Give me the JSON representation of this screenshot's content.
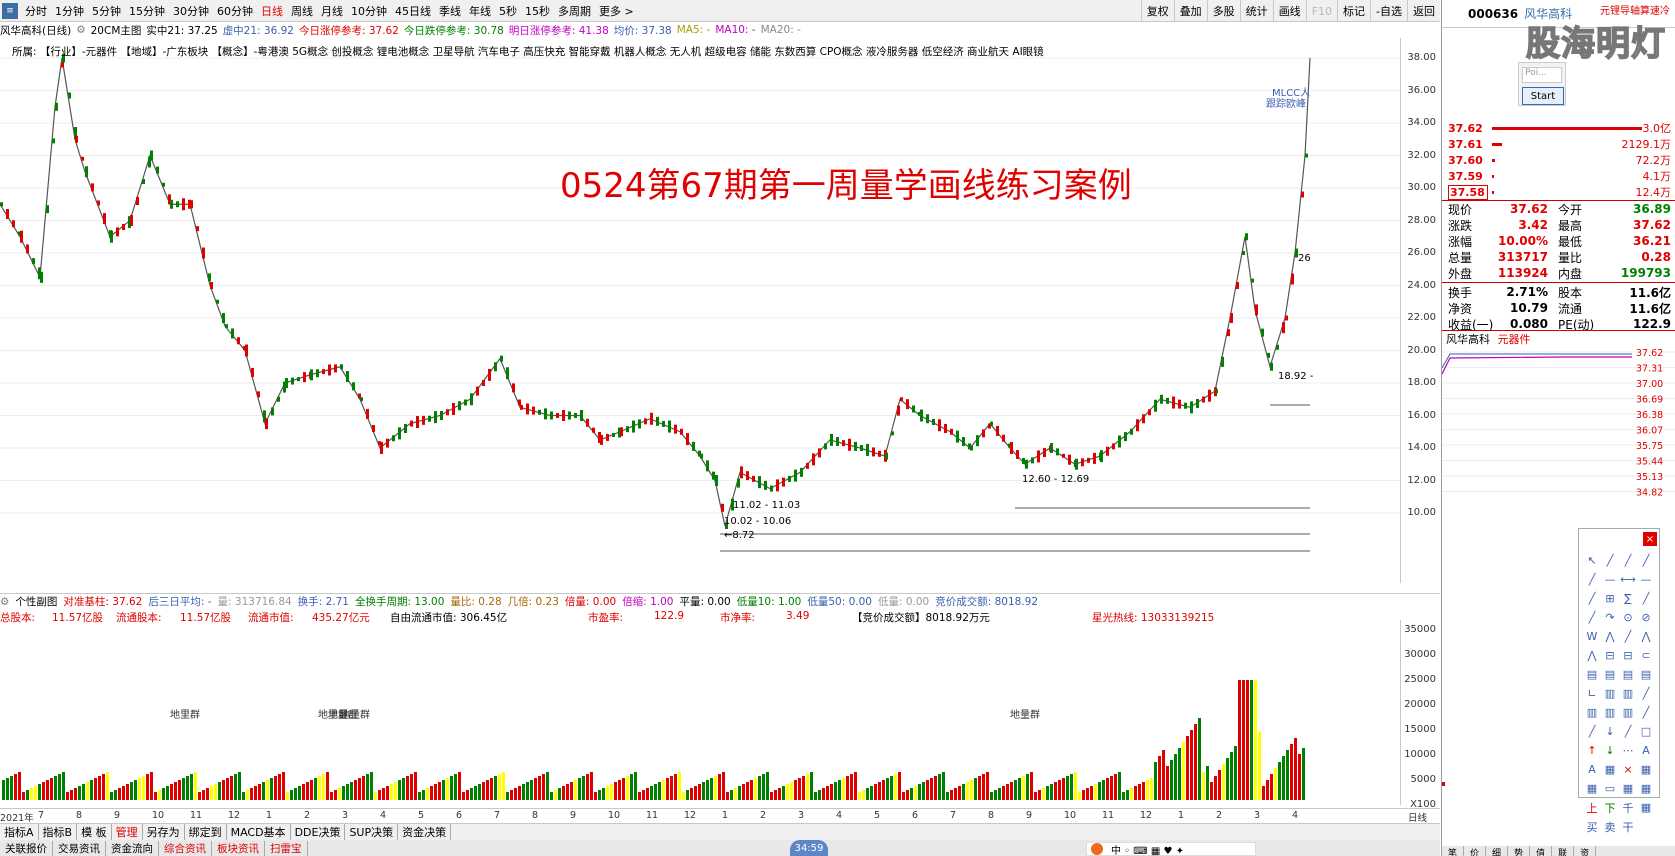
{
  "topbar": {
    "periods": [
      "分时",
      "1分钟",
      "5分钟",
      "15分钟",
      "30分钟",
      "60分钟",
      "日线",
      "周线",
      "月线",
      "10分钟",
      "45日线",
      "季线",
      "年线",
      "5秒",
      "15秒",
      "多周期",
      "更多 >"
    ],
    "active_period": "日线",
    "right_buttons": [
      "复权",
      "叠加",
      "多股",
      "统计",
      "画线",
      "F10",
      "标记",
      "-自选",
      "返回"
    ]
  },
  "infoline": {
    "title": "风华高科(日线)",
    "main_indicator": "20CM主图",
    "realtime": "实中21: 37.25",
    "virtual": "虚中21: 36.92",
    "limit_up_ref": "今日涨停参考: 37.62",
    "limit_down_ref": "今日跌停参考: 30.78",
    "tomorrow_ref": "明日涨停参考: 41.38",
    "avg_price": "均价: 37.38",
    "ma5": "MA5: -",
    "ma10": "MA10: -",
    "ma20": "MA20: -"
  },
  "concept_line": "所属:   【行业】-元器件  【地域】-广东板块     【概念】-粤港澳 5G概念 创投概念 锂电池概念 卫星导航 汽车电子 高压快充 智能穿戴 机器人概念 无人机 超级电容 储能 东数西算 CPO概念 液冷服务器 低空经济 商业航天 AI眼镜",
  "overlay_title": "0524第67期第一周量学画线练习案例",
  "main_axis": [
    "38.00",
    "36.00",
    "34.00",
    "32.00",
    "30.00",
    "28.00",
    "26.00",
    "24.00",
    "22.00",
    "20.00",
    "18.00",
    "16.00",
    "14.00",
    "12.00",
    "10.00"
  ],
  "annotations": {
    "low_price": "8.72",
    "band1": "11.02 - 11.03",
    "band2": "10.02 - 10.06",
    "band3": "12.60 - 12.69",
    "mark18": "18.92 -",
    "mark26": "26",
    "mlcc1": "MLCC人",
    "mlcc2": "跟踪欧峰"
  },
  "subhead": {
    "label": "个性副图",
    "duiwei": "对准基柱: 37.62",
    "three_day": "后三日平均: -",
    "liang": "量: 313716.84",
    "turnover": "换手: 2.71",
    "full_turnover": "全换手周期: 13.00",
    "ratio": "量比: 0.28",
    "jibei": "几倍: 0.23",
    "beiliang": "倍量: 0.00",
    "beisuo": "倍缩: 1.00",
    "pingliang": "平量: 0.00",
    "diliang10": "低量10: 1.00",
    "diliang50": "低量50: 0.00",
    "diliang": "低量: 0.00",
    "auction": "竞价成交额: 8018.92"
  },
  "subline2": {
    "total_shares_l": "总股本:",
    "total_shares_v": "11.57亿股",
    "float_shares_l": "流通股本:",
    "float_shares_v": "11.57亿股",
    "float_mv_l": "流通市值:",
    "float_mv_v": "435.27亿元",
    "free_mv": "自由流通市值: 306.45亿",
    "pe_l": "市盈率:",
    "pe_v": "122.9",
    "pb_l": "市净率:",
    "pb_v": "3.49",
    "auction2": "【竞价成交额】8018.92万元",
    "hotline": "星光热线: 13033139215"
  },
  "vol_axis": [
    "35000",
    "30000",
    "25000",
    "20000",
    "15000",
    "10000",
    "5000",
    "X100"
  ],
  "vol_labels": [
    "地里群",
    "地里群",
    "地量群",
    "地量群",
    "地量群"
  ],
  "date_axis": [
    "2021年",
    "7",
    "8",
    "9",
    "10",
    "11",
    "12",
    "1",
    "2",
    "3",
    "4",
    "5",
    "6",
    "7",
    "8",
    "9",
    "10",
    "11",
    "12",
    "1",
    "2",
    "3",
    "4",
    "5",
    "6",
    "7",
    "8",
    "9",
    "10",
    "11",
    "12",
    "1",
    "2",
    "3",
    "4",
    "日线"
  ],
  "bottom_tabs": [
    "指标A",
    "指标B",
    "模 板",
    "管理",
    "另存为",
    "绑定到",
    "MACD基本",
    "DDE决策",
    "SUP决策",
    "资金决策"
  ],
  "bottom_active": "管理",
  "bottom_tabs2": [
    "关联报价",
    "交易资讯",
    "资金流向",
    "综合资讯",
    "板块资讯",
    "扫雷宝"
  ],
  "clock": "34:59",
  "right": {
    "code": "000636",
    "name": "风华高科",
    "ad": "元锂导轴算速冷",
    "watermark": "股海明灯",
    "popup_input": "Poi...",
    "popup_button": "Start",
    "sells": [
      {
        "price": "37.62",
        "vol": "3.0亿",
        "w": 150
      },
      {
        "price": "37.61",
        "vol": "2129.1万",
        "w": 10
      },
      {
        "price": "37.60",
        "vol": "72.2万",
        "w": 3
      },
      {
        "price": "37.59",
        "vol": "4.1万",
        "w": 2
      },
      {
        "price": "37.58",
        "vol": "12.4万",
        "w": 2
      }
    ],
    "quote": [
      {
        "l1": "现价",
        "v1": "37.62",
        "l2": "今开",
        "v2": "36.89",
        "c2": "green"
      },
      {
        "l1": "涨跌",
        "v1": "3.42",
        "l2": "最高",
        "v2": "37.62",
        "c2": "redc"
      },
      {
        "l1": "涨幅",
        "v1": "10.00%",
        "l2": "最低",
        "v2": "36.21",
        "c2": "redc"
      },
      {
        "l1": "总量",
        "v1": "313717",
        "l2": "量比",
        "v2": "0.28",
        "c2": "redc"
      },
      {
        "l1": "外盘",
        "v1": "113924",
        "l2": "内盘",
        "v2": "199793",
        "c2": "green"
      }
    ],
    "quote2": [
      {
        "l1": "换手",
        "v1": "2.71%",
        "l2": "股本",
        "v2": "11.6亿"
      },
      {
        "l1": "净资",
        "v1": "10.79",
        "l2": "流通",
        "v2": "11.6亿"
      },
      {
        "l1": "收益(一)",
        "v1": "0.080",
        "l2": "PE(动)",
        "v2": "122.9"
      }
    ],
    "mini_name": "风华高科",
    "mini_sector": "元器件",
    "mini_axis": [
      "37.62",
      "37.31",
      "37.00",
      "36.69",
      "36.38",
      "36.07",
      "35.75",
      "35.44",
      "35.13",
      "34.82"
    ],
    "bottom": [
      "笔",
      "价",
      "细",
      "势",
      "值",
      "联",
      "资"
    ]
  },
  "colors": {
    "up": "#e00000",
    "down": "#008000",
    "accent": "#3a6ea5"
  }
}
